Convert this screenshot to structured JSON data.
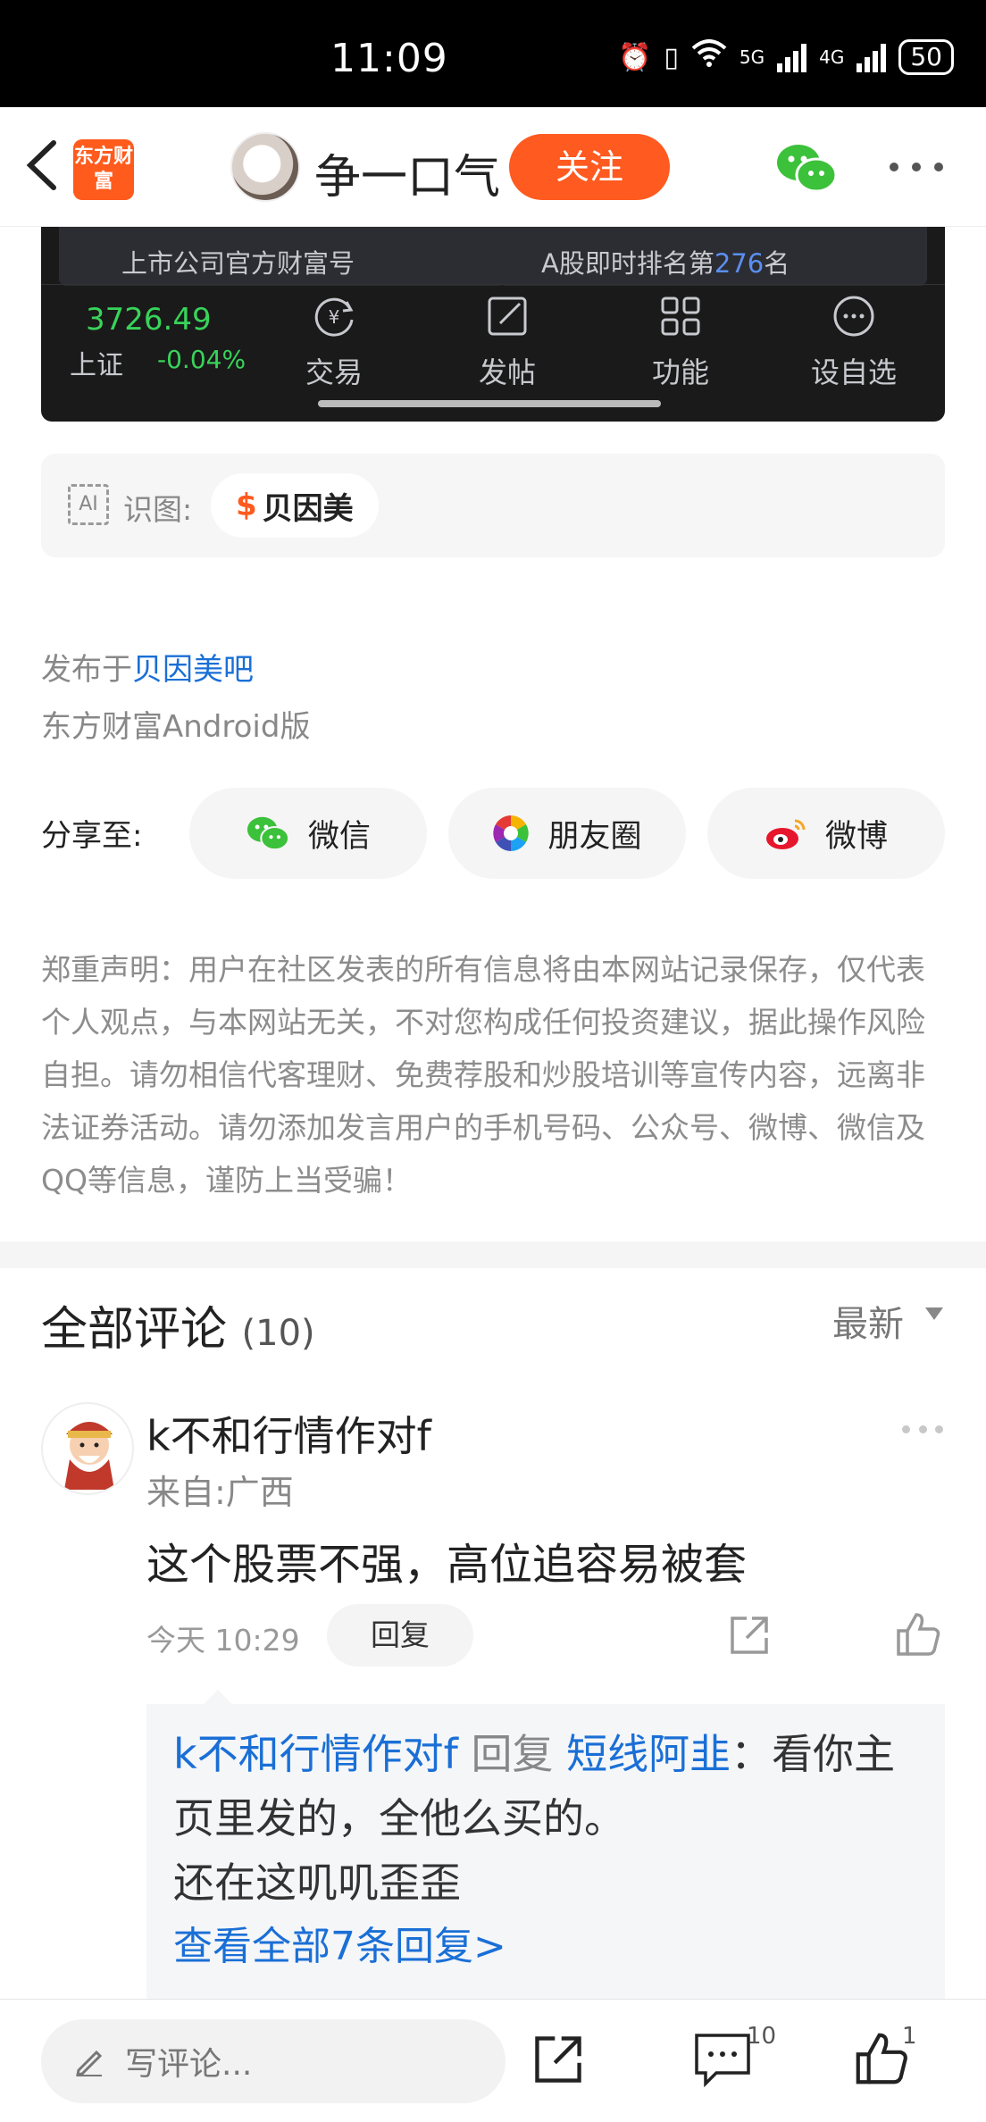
{
  "status_bar": {
    "time": "11:09",
    "network_5g": "5G",
    "network_4g": "4G",
    "battery": "50"
  },
  "nav": {
    "logo_text": "东方财富",
    "user_name": "争一口气",
    "follow_label": "关注"
  },
  "stock_panel": {
    "card1_text": "上市公司官方财富号",
    "card2_prefix": "A股即时排名第",
    "card2_rank": "276",
    "card2_suffix": "名",
    "index_value": "3726.49",
    "index_name": "上证",
    "index_change": "-0.04%",
    "tools": [
      {
        "label": "交易",
        "icon": "yuan-cycle-icon"
      },
      {
        "label": "发帖",
        "icon": "edit-icon"
      },
      {
        "label": "功能",
        "icon": "grid-icon"
      },
      {
        "label": "设自选",
        "icon": "more-circle-icon"
      }
    ]
  },
  "ai_recognize": {
    "icon_text": "AI",
    "label": "识图:",
    "stock_symbol": "$",
    "stock_name": "贝因美"
  },
  "post_meta": {
    "published_prefix": "发布于",
    "bar_name": "贝因美吧",
    "platform": "东方财富Android版"
  },
  "share": {
    "label": "分享至:",
    "wechat": "微信",
    "moments": "朋友圈",
    "weibo": "微博"
  },
  "disclaimer": "郑重声明：用户在社区发表的所有信息将由本网站记录保存，仅代表个人观点，与本网站无关，不对您构成任何投资建议，据此操作风险自担。请勿相信代客理财、免费荐股和炒股培训等宣传内容，远离非法证券活动。请勿添加发言用户的手机号码、公众号、微博、微信及QQ等信息，谨防上当受骗！",
  "comments": {
    "title": "全部评论",
    "count": "(10)",
    "sort": "最新",
    "item": {
      "author": "k不和行情作对f",
      "location": "来自:广西",
      "text": "这个股票不强，高位追容易被套",
      "time": "今天 10:29",
      "reply_label": "回复",
      "reply": {
        "author": "k不和行情作对f",
        "verb": "回复",
        "target": "短线阿韭",
        "text": "：看你主页里发的，全他么买的。",
        "text2": "还在这叽叽歪歪",
        "more": "查看全部7条回复>"
      }
    }
  },
  "bottom_bar": {
    "input_placeholder": "写评论...",
    "comment_count": "10",
    "like_count": "1"
  },
  "colors": {
    "accent": "#ff5a1f",
    "link": "#1a6fd6",
    "up_green": "#38d35a",
    "panel_bg": "#1a1a1a"
  }
}
